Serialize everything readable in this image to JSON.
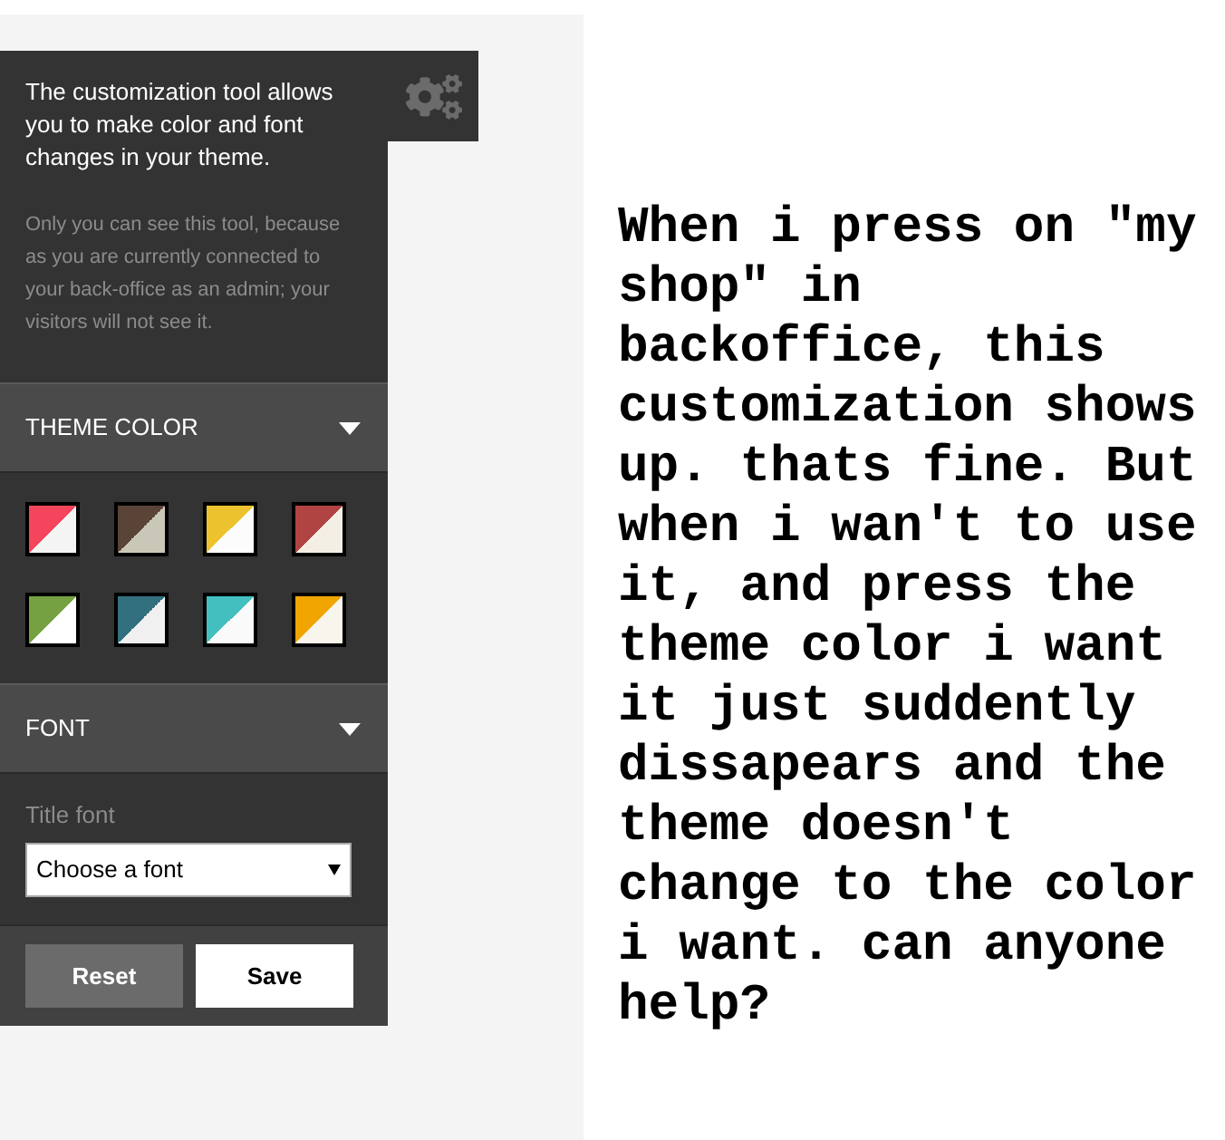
{
  "tool_panel": {
    "intro": "The customization tool allows you to make color and font changes in your theme.",
    "note": "Only you can see this tool, because as you are currently connected to your back-office as an admin; your visitors will not see it."
  },
  "sections": [
    {
      "kind": "colors",
      "title": "THEME COLOR",
      "swatches": [
        {
          "parts": [
            {
              "color": "#f5455c"
            },
            {
              "color": "#f4f4f4"
            }
          ]
        },
        {
          "parts": [
            {
              "color": "#5a4337"
            },
            {
              "color": "#c9c8b8"
            }
          ]
        },
        {
          "parts": [
            {
              "color": "#ecc32e"
            },
            {
              "color": "#fcfcfc"
            }
          ]
        },
        {
          "parts": [
            {
              "color": "#b04443"
            },
            {
              "color": "#f4efe5"
            }
          ]
        },
        {
          "parts": [
            {
              "color": "#76a143"
            },
            {
              "color": "#ffffff"
            }
          ]
        },
        {
          "parts": [
            {
              "color": "#327080"
            },
            {
              "color": "#f0f0f0"
            }
          ]
        },
        {
          "parts": [
            {
              "color": "#43bfbf"
            },
            {
              "color": "#fafafa"
            }
          ]
        },
        {
          "parts": [
            {
              "color": "#f0a500"
            },
            {
              "color": "#f8f5ec"
            }
          ]
        }
      ]
    },
    {
      "kind": "font",
      "title": "FONT",
      "field_label": "Title font",
      "select": {
        "value": "Choose a font"
      }
    }
  ],
  "buttons": [
    {
      "kind": "secondary",
      "label": "Reset"
    },
    {
      "kind": "primary",
      "label": "Save"
    }
  ],
  "question": "When i press on \"my shop\" in backoffice, this customization shows up. thats fine. But when i wan't to use it, and press the theme color i want it just suddently dissapears and the theme doesn't change to the color i want. can anyone help?"
}
